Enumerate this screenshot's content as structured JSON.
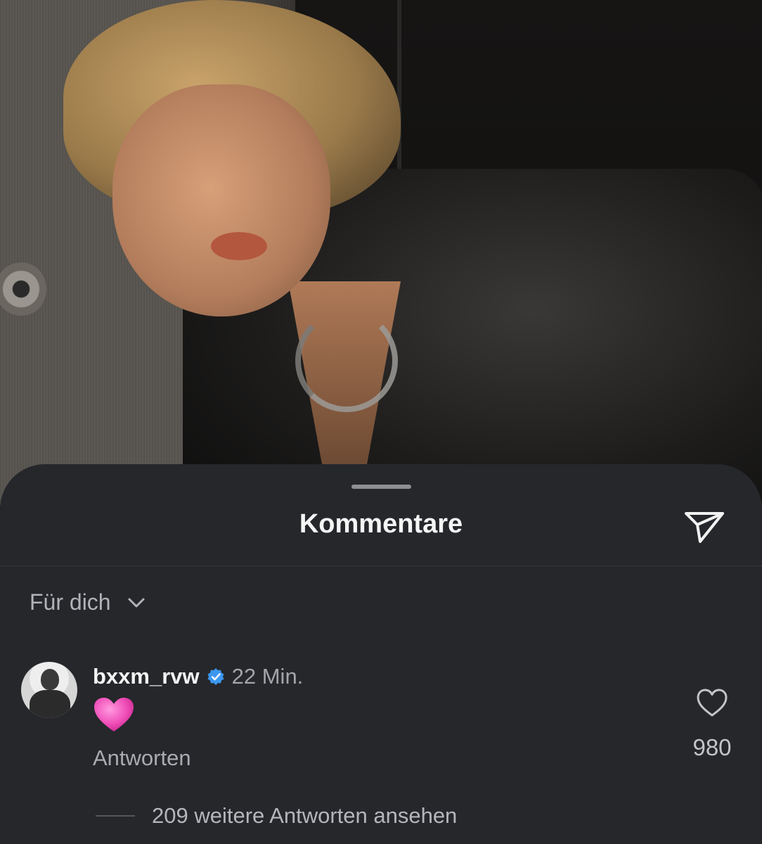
{
  "sheet": {
    "title": "Kommentare",
    "share_icon": "paper-plane-icon"
  },
  "filter": {
    "label": "Für dich",
    "icon": "chevron-down-icon"
  },
  "comment": {
    "username": "bxxm_rvw",
    "verified": true,
    "time": "22 Min.",
    "text_emoji": "pink-heart",
    "reply_label": "Antworten",
    "like_count": "980",
    "more_replies": "209 weitere Antworten ansehen"
  },
  "colors": {
    "sheet_bg": "#25272b",
    "verified_blue": "#3b97f0",
    "heart_pink": "#f04fb8"
  }
}
